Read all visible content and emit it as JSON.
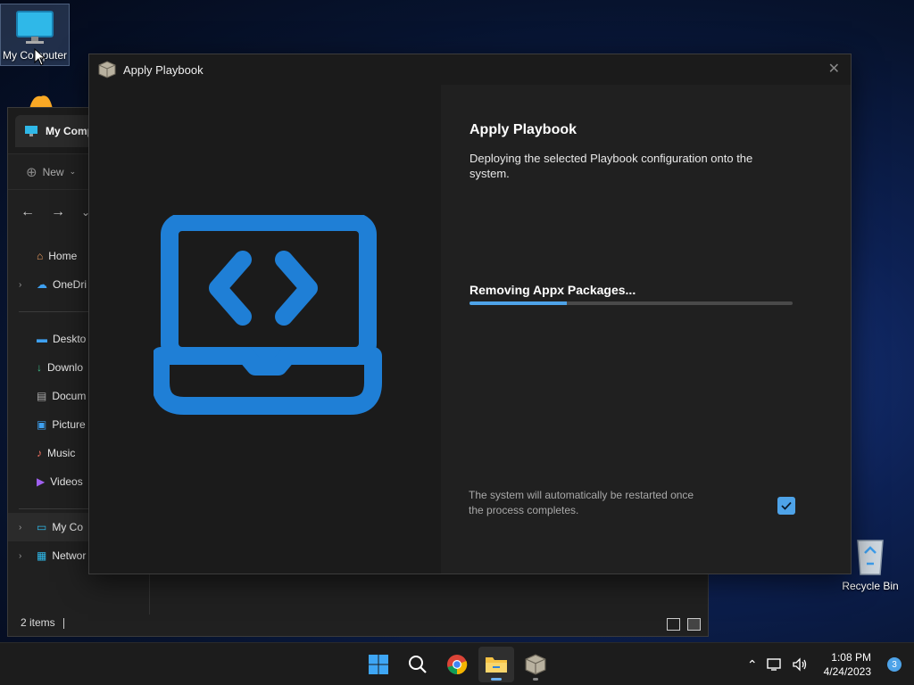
{
  "desktop": {
    "my_computer_label": "My Computer",
    "recycle_bin_label": "Recycle Bin"
  },
  "explorer": {
    "tab_title": "My Comp",
    "new_label": "New",
    "sidebar": [
      {
        "label": "Home",
        "icon": "home-icon"
      },
      {
        "label": "OneDri",
        "icon": "onedrive-icon"
      },
      {
        "label": "Deskto",
        "icon": "desktop-folder-icon"
      },
      {
        "label": "Downlo",
        "icon": "download-icon"
      },
      {
        "label": "Docum",
        "icon": "documents-icon"
      },
      {
        "label": "Picture",
        "icon": "pictures-icon"
      },
      {
        "label": "Music",
        "icon": "music-icon"
      },
      {
        "label": "Videos",
        "icon": "videos-icon"
      },
      {
        "label": "My Co",
        "icon": "computer-icon"
      },
      {
        "label": "Networ",
        "icon": "network-icon"
      }
    ],
    "status_items": "2 items"
  },
  "dialog": {
    "title": "Apply Playbook",
    "heading": "Apply Playbook",
    "description": "Deploying the selected Playbook configuration onto the system.",
    "progress_label": "Removing Appx Packages...",
    "progress_fraction": 0.3,
    "note": "The system will automatically be restarted once the process completes.",
    "restart_checked": true,
    "accent_color": "#4ea3e8"
  },
  "taskbar": {
    "time": "1:08 PM",
    "date": "4/24/2023",
    "notification_count": "3"
  }
}
